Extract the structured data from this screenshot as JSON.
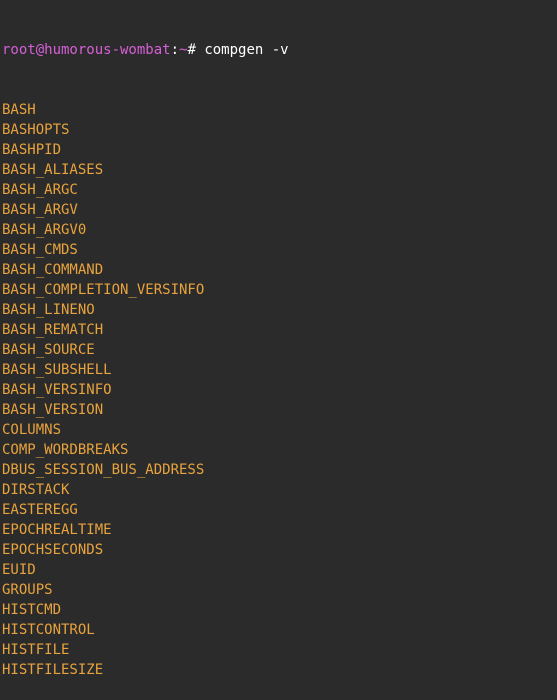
{
  "prompt": {
    "user_host": "root@humorous-wombat",
    "separator": ":",
    "path": "~",
    "symbol": "#"
  },
  "command": "compgen -v",
  "output": [
    "BASH",
    "BASHOPTS",
    "BASHPID",
    "BASH_ALIASES",
    "BASH_ARGC",
    "BASH_ARGV",
    "BASH_ARGV0",
    "BASH_CMDS",
    "BASH_COMMAND",
    "BASH_COMPLETION_VERSINFO",
    "BASH_LINENO",
    "BASH_REMATCH",
    "BASH_SOURCE",
    "BASH_SUBSHELL",
    "BASH_VERSINFO",
    "BASH_VERSION",
    "COLUMNS",
    "COMP_WORDBREAKS",
    "DBUS_SESSION_BUS_ADDRESS",
    "DIRSTACK",
    "EASTEREGG",
    "EPOCHREALTIME",
    "EPOCHSECONDS",
    "EUID",
    "GROUPS",
    "HISTCMD",
    "HISTCONTROL",
    "HISTFILE",
    "HISTFILESIZE"
  ]
}
